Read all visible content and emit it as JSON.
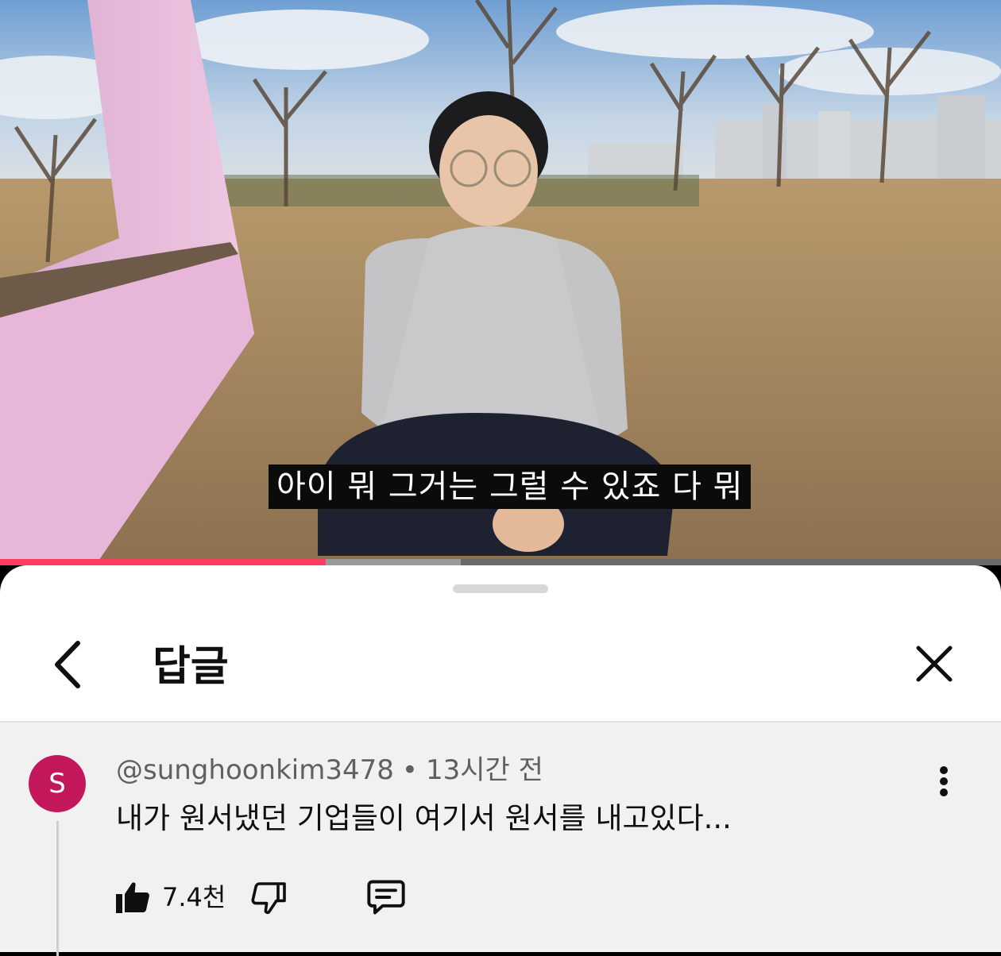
{
  "video": {
    "subtitle": "아이 뭐 그거는 그럴 수 있죠 다 뭐",
    "progress_fraction": 0.325,
    "buffered_fraction": 0.46
  },
  "sheet": {
    "title": "답글",
    "icons": {
      "back": "chevron-left-icon",
      "close": "close-icon"
    }
  },
  "comment": {
    "avatar_letter": "S",
    "avatar_color": "#c2185b",
    "author": "@sunghoonkim3478",
    "separator": "•",
    "time": "13시간 전",
    "text": "내가 원서냈던 기업들이 여기서 원서를 내고있다...",
    "like_count": "7.4천",
    "icons": {
      "like": "thumbs-up-filled-icon",
      "dislike": "thumbs-down-outline-icon",
      "reply": "comment-bubble-icon",
      "more": "more-vertical-icon"
    }
  },
  "colors": {
    "progress_accent": "#ff3d5f",
    "sheet_bg": "#ffffff",
    "comment_bg": "#f1f1f1"
  }
}
